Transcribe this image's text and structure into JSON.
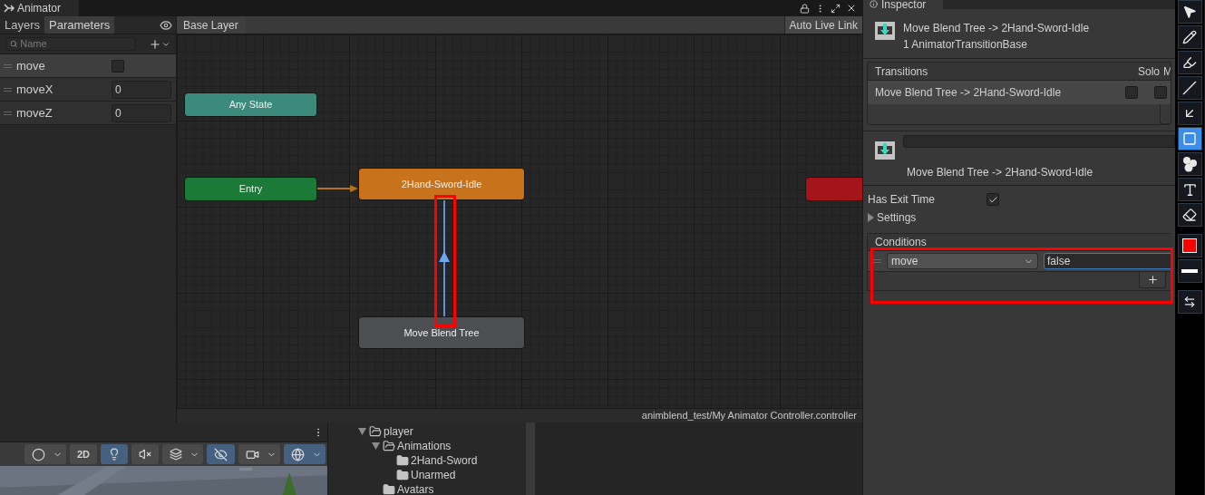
{
  "animator_tab": {
    "title": "Animator"
  },
  "parameters_panel": {
    "tabs": [
      {
        "label": "Layers",
        "selected": false
      },
      {
        "label": "Parameters",
        "selected": true
      }
    ],
    "search": {
      "placeholder": "Name"
    },
    "parameters": [
      {
        "name": "move",
        "kind": "bool",
        "checked": false,
        "selected": true
      },
      {
        "name": "moveX",
        "kind": "float",
        "value": "0",
        "selected": false
      },
      {
        "name": "moveZ",
        "kind": "float",
        "value": "0",
        "selected": false
      }
    ]
  },
  "graph": {
    "breadcrumb": "Base Layer",
    "auto_live_link": "Auto Live Link",
    "states": [
      {
        "name": "Any State",
        "color": "#3b8a7c"
      },
      {
        "name": "Entry",
        "color": "#1b7a38"
      },
      {
        "name": "2Hand-Sword-Idle",
        "color": "#c8721c"
      },
      {
        "name": "Move Blend Tree",
        "color": "#4d4e52"
      },
      {
        "color": "#a3151a"
      }
    ],
    "status_bar": "animblend_test/My Animator Controller.controller"
  },
  "inspector": {
    "tab": "Inspector",
    "title": "Move Blend Tree -> 2Hand-Sword-Idle",
    "subtitle": "1 AnimatorTransitionBase",
    "transitions": {
      "header": "Transitions",
      "solo_header": "Solo",
      "mute_header": "M",
      "rows": [
        {
          "name": "Move Blend Tree -> 2Hand-Sword-Idle",
          "selected": true,
          "solo": false,
          "mute": false
        }
      ]
    },
    "transition_label": "Move Blend Tree -> 2Hand-Sword-Idle",
    "has_exit_time": {
      "label": "Has Exit Time",
      "checked": true
    },
    "settings": {
      "label": "Settings",
      "expanded": false
    },
    "conditions": {
      "header": "Conditions",
      "rows": [
        {
          "parameter": "move",
          "value": "false"
        }
      ]
    }
  },
  "scene_toolbar": [
    {
      "kind": "shading",
      "selected": false,
      "dropdown": true
    },
    {
      "kind": "dimension",
      "label": "2D",
      "selected": false
    },
    {
      "kind": "light",
      "selected": true
    },
    {
      "kind": "audio",
      "selected": false
    },
    {
      "kind": "effects",
      "selected": false,
      "dropdown": true
    },
    {
      "kind": "visibility",
      "selected": true
    },
    {
      "kind": "camera",
      "selected": false,
      "dropdown": true
    },
    {
      "kind": "gizmos",
      "selected": true,
      "dropdown": true
    }
  ],
  "project_tree": [
    {
      "name": "player",
      "expanded": true,
      "children": [
        {
          "name": "Animations",
          "expanded": true,
          "children": [
            {
              "name": "2Hand-Sword"
            },
            {
              "name": "Unarmed"
            }
          ]
        },
        {
          "name": "Avatars"
        }
      ]
    }
  ],
  "annotation_tools": [
    {
      "kind": "pointer",
      "selected": false
    },
    {
      "kind": "pencil",
      "selected": false
    },
    {
      "kind": "marker",
      "selected": false
    },
    {
      "kind": "line",
      "selected": false
    },
    {
      "kind": "arrow",
      "selected": false
    },
    {
      "kind": "rectangle",
      "selected": true
    },
    {
      "kind": "numbers",
      "selected": false
    },
    {
      "kind": "text",
      "selected": false
    },
    {
      "kind": "eraser",
      "selected": false
    },
    {
      "kind": "color",
      "color": "#ff0000",
      "selected": false
    },
    {
      "kind": "width",
      "selected": false
    },
    {
      "kind": "flip",
      "selected": false
    }
  ]
}
